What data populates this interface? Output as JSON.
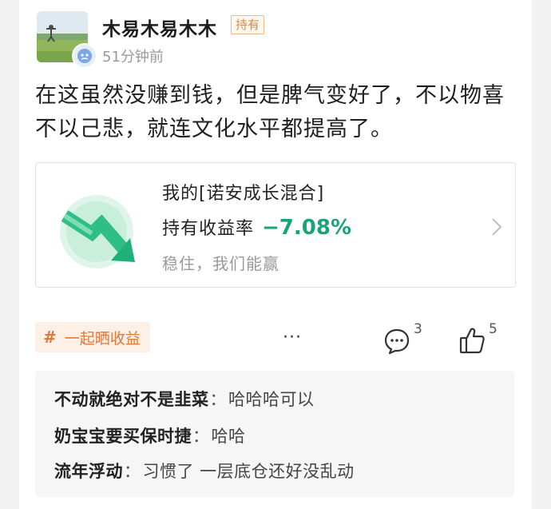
{
  "post": {
    "username": "木易木易木木",
    "holding_tag": "持有",
    "timestamp": "51分钟前",
    "text": "在这虽然没赚到钱，但是脾气变好了，不以物喜不以己悲，就连文化水平都提高了。"
  },
  "fund_card": {
    "fund_name": "我的[诺安成长混合]",
    "return_label": "持有收益率",
    "return_value": "−7.08%",
    "slogan": "稳住，我们能赢",
    "return_color": "#1aa37a"
  },
  "actions": {
    "topic_hash": "#",
    "topic_label": "一起晒收益",
    "more": "···",
    "comment_count": "3",
    "like_count": "5",
    "icons": [
      "comment-icon",
      "thumbs-up-icon",
      "more-icon"
    ]
  },
  "comments": [
    {
      "user": "不动就绝对不是韭菜",
      "sep": "：",
      "text": "哈哈哈可以"
    },
    {
      "user": "奶宝宝要买保时捷",
      "sep": "：",
      "text": "哈哈"
    },
    {
      "user": "流年浮动",
      "sep": "：",
      "text": "习惯了 一层底仓还好没乱动"
    }
  ]
}
